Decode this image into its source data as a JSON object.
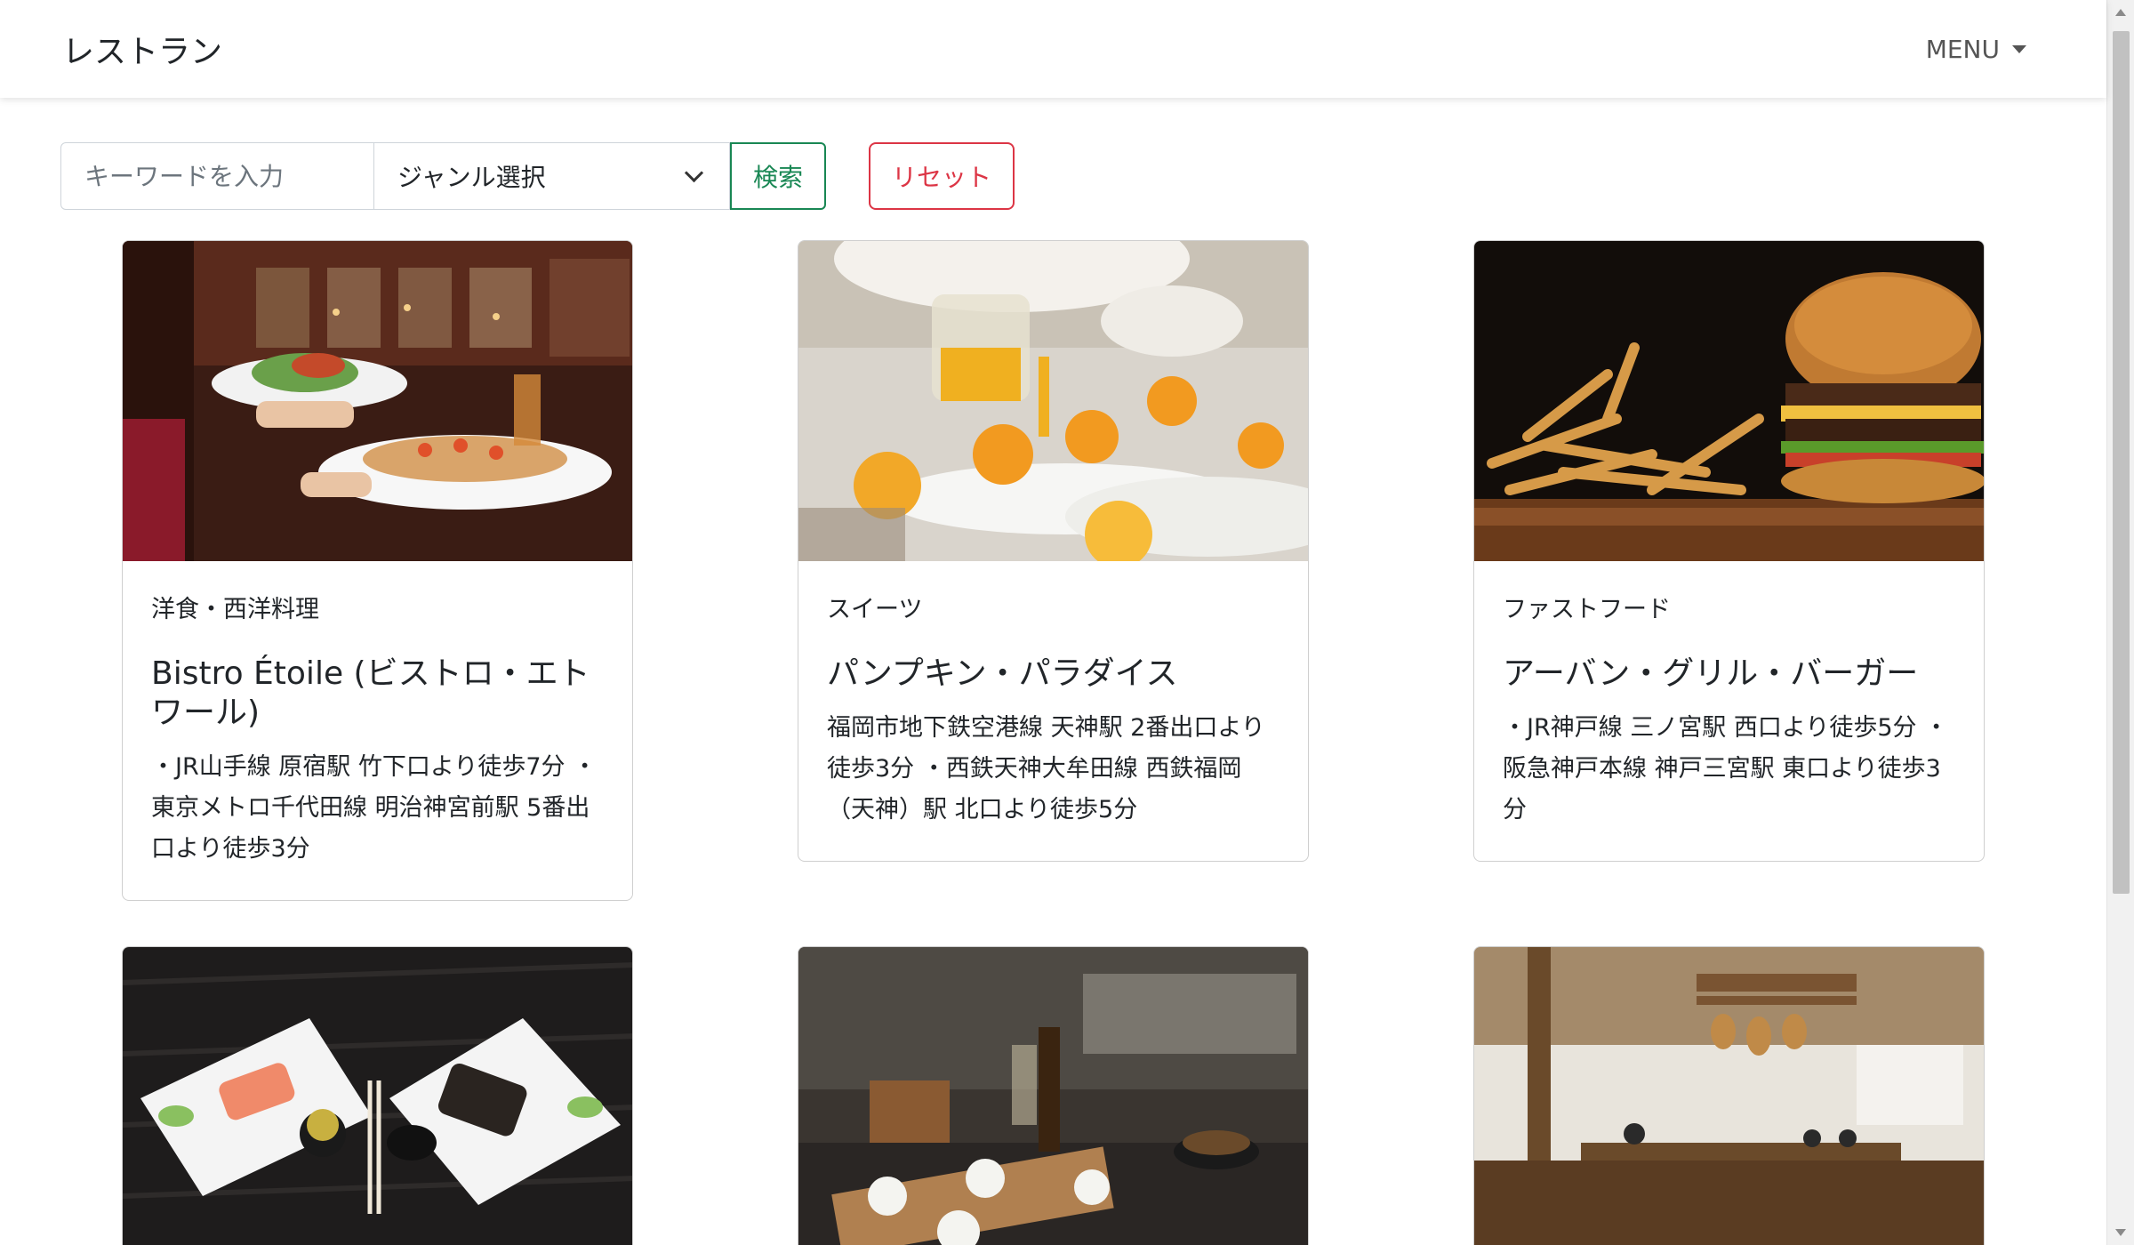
{
  "header": {
    "brand": "レストラン",
    "menu_label": "MENU"
  },
  "search": {
    "keyword_placeholder": "キーワードを入力",
    "keyword_value": "",
    "genre_selected": "ジャンル選択",
    "search_button": "検索",
    "reset_button": "リセット"
  },
  "colors": {
    "search_accent": "#198754",
    "reset_accent": "#dc3545"
  },
  "restaurants": [
    {
      "genre": "洋食・西洋料理",
      "name": "Bistro Étoile (ビストロ・エトワール)",
      "access": "・JR山手線 原宿駅 竹下口より徒歩7分 ・東京メトロ千代田線 明治神宮前駅 5番出口より徒歩3分",
      "image": "waiter-serving-dishes-photo"
    },
    {
      "genre": "スイーツ",
      "name": "パンプキン・パラダイス",
      "access": "福岡市地下鉄空港線 天神駅 2番出口より徒歩3分 ・西鉄天神大牟田線 西鉄福岡（天神）駅 北口より徒歩5分",
      "image": "pumpkin-dessert-photo"
    },
    {
      "genre": "ファストフード",
      "name": "アーバン・グリル・バーガー",
      "access": "・JR神戸線 三ノ宮駅 西口より徒歩5分 ・阪急神戸本線 神戸三宮駅 東口より徒歩3分",
      "image": "burger-fries-photo"
    },
    {
      "genre": "",
      "name": "",
      "access": "",
      "image": "sushi-plates-photo"
    },
    {
      "genre": "",
      "name": "",
      "access": "",
      "image": "cafe-platter-photo"
    },
    {
      "genre": "",
      "name": "",
      "access": "",
      "image": "wooden-interior-photo"
    }
  ]
}
